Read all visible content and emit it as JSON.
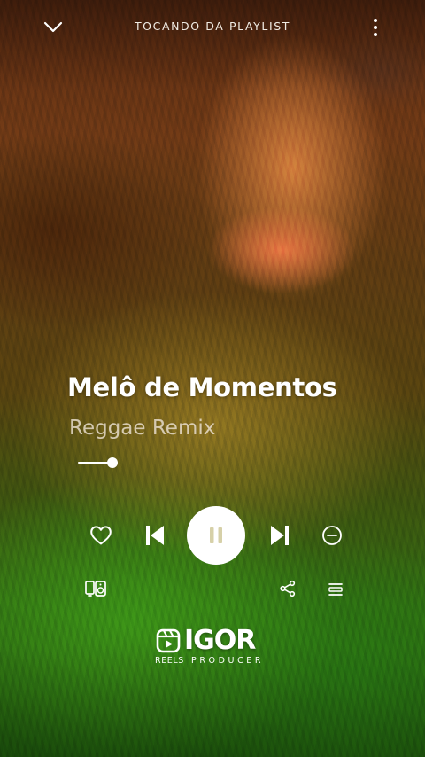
{
  "header": {
    "playing_from": "TOCANDO DA PLAYLIST",
    "collapse_icon": "chevron-down-icon",
    "menu_icon": "more-vertical-icon"
  },
  "track": {
    "title": "Melô de Momentos",
    "subtitle": "Reggae Remix"
  },
  "progress": {
    "fraction": 0.13
  },
  "controls": {
    "like_icon": "heart-outline-icon",
    "prev_icon": "skip-previous-icon",
    "play_state": "playing",
    "play_icon": "pause-icon",
    "next_icon": "skip-next-icon",
    "remove_icon": "minus-circle-icon",
    "device_icon": "connect-device-icon",
    "share_icon": "share-icon",
    "queue_icon": "queue-icon"
  },
  "watermark": {
    "brand": "IGOR",
    "sub_left": "REELS",
    "sub_right": "PRODUCER"
  },
  "colors": {
    "foreground": "#ffffff",
    "art_top": "#6b3816",
    "art_bottom": "#2f6a12"
  }
}
